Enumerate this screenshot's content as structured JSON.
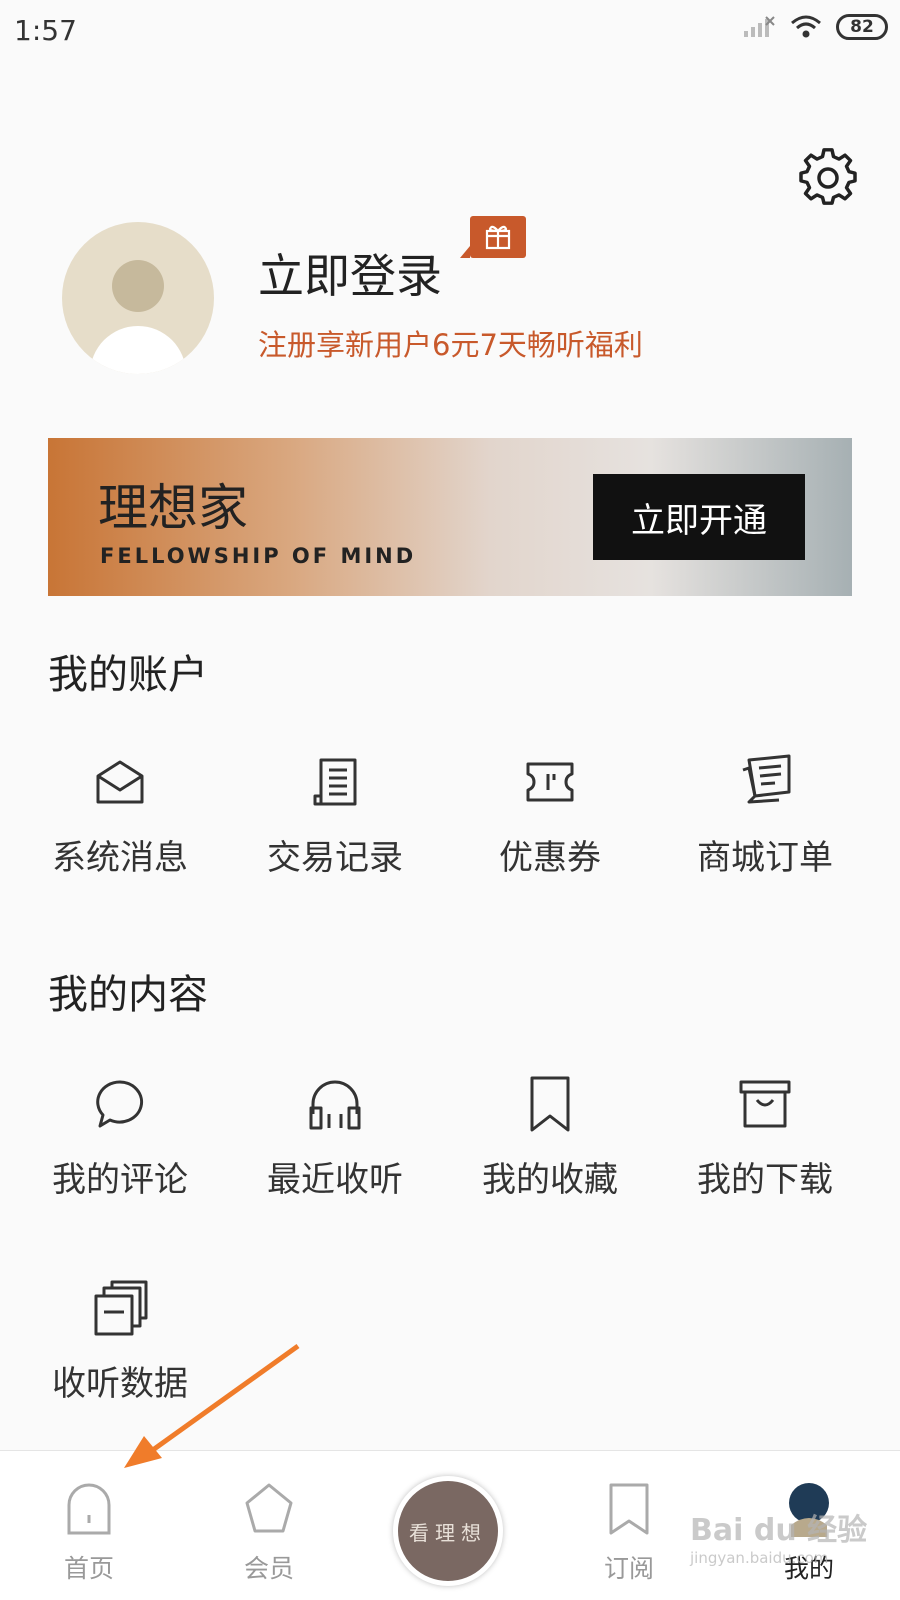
{
  "status_bar": {
    "time": "1:57",
    "battery": "82"
  },
  "profile": {
    "login_title": "立即登录",
    "login_subtitle": "注册享新用户6元7天畅听福利"
  },
  "vip_banner": {
    "title": "理想家",
    "subtitle": "FELLOWSHIP OF MIND",
    "button": "立即开通"
  },
  "account_section": {
    "title": "我的账户",
    "items": [
      {
        "label": "系统消息",
        "icon": "envelope-icon"
      },
      {
        "label": "交易记录",
        "icon": "receipt-icon"
      },
      {
        "label": "优惠券",
        "icon": "ticket-icon"
      },
      {
        "label": "商城订单",
        "icon": "order-list-icon"
      }
    ]
  },
  "content_section": {
    "title": "我的内容",
    "items": [
      {
        "label": "我的评论",
        "icon": "comment-icon"
      },
      {
        "label": "最近收听",
        "icon": "headphones-icon"
      },
      {
        "label": "我的收藏",
        "icon": "bookmark-icon"
      },
      {
        "label": "我的下载",
        "icon": "download-box-icon"
      },
      {
        "label": "收听数据",
        "icon": "stats-icon"
      }
    ]
  },
  "tabbar": {
    "home": "首页",
    "member": "会员",
    "center": "看理想",
    "subscribe": "订阅",
    "mine": "我的"
  },
  "watermark": {
    "line1": "Bai du 经验",
    "line2": "jingyan.baidu.com"
  },
  "colors": {
    "accent": "#c8592b",
    "background": "#fafafa"
  }
}
